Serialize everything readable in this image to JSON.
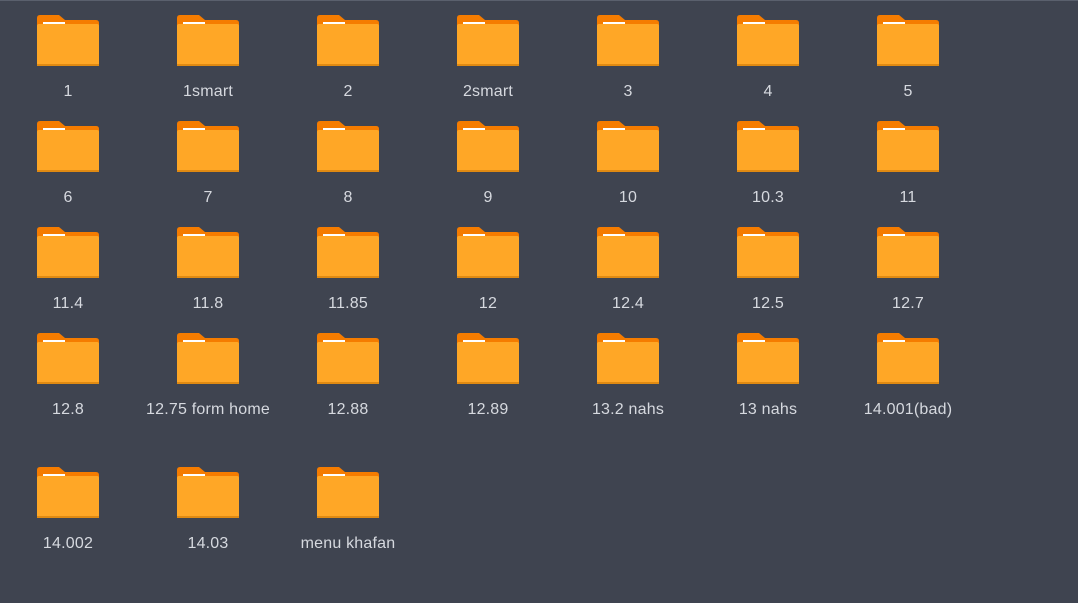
{
  "window": {
    "title": ""
  },
  "colors": {
    "background": "#3f4450",
    "folder_body": "#ffa726",
    "folder_tab": "#f57c00",
    "label": "#d6d9df"
  },
  "icons": {
    "folder": "folder-icon"
  },
  "folders": [
    {
      "name": "1"
    },
    {
      "name": "1smart"
    },
    {
      "name": "2"
    },
    {
      "name": "2smart"
    },
    {
      "name": "3"
    },
    {
      "name": "4"
    },
    {
      "name": "5"
    },
    {
      "name": "6"
    },
    {
      "name": "7"
    },
    {
      "name": "8"
    },
    {
      "name": "9"
    },
    {
      "name": "10"
    },
    {
      "name": "10.3"
    },
    {
      "name": "11"
    },
    {
      "name": "11.4"
    },
    {
      "name": "11.8"
    },
    {
      "name": "11.85"
    },
    {
      "name": "12"
    },
    {
      "name": "12.4"
    },
    {
      "name": "12.5"
    },
    {
      "name": "12.7"
    },
    {
      "name": "12.8"
    },
    {
      "name": "12.75 form home"
    },
    {
      "name": "12.88"
    },
    {
      "name": "12.89"
    },
    {
      "name": "13.2 nahs"
    },
    {
      "name": "13 nahs"
    },
    {
      "name": "14.001(bad)"
    },
    {
      "name": "14.002"
    },
    {
      "name": "14.03"
    },
    {
      "name": "menu khafan"
    }
  ]
}
